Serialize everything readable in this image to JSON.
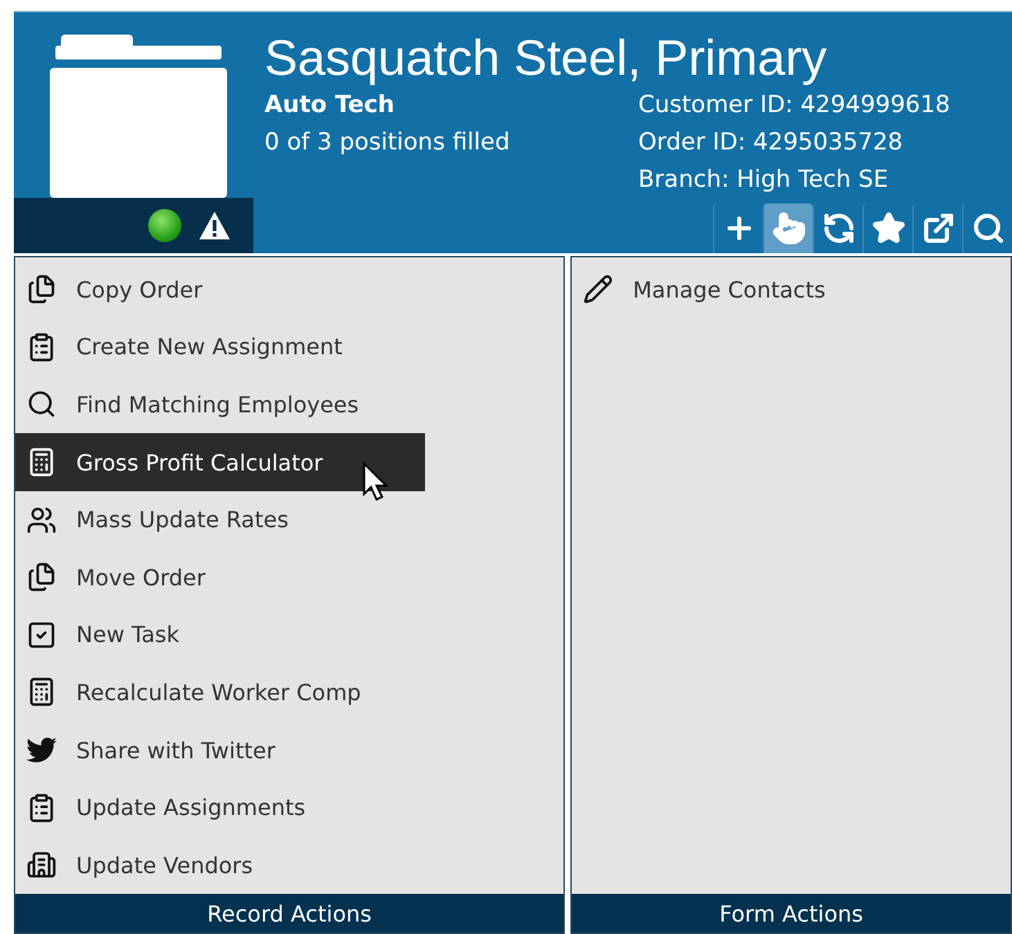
{
  "header": {
    "title": "Sasquatch Steel, Primary",
    "subtitle": "Auto Tech",
    "positions": "0 of 3 positions filled",
    "details": [
      "Customer ID: 4294999618",
      "Order ID: 4295035728",
      "Branch: High Tech SE"
    ]
  },
  "toolbar": [
    {
      "selected": false
    },
    {
      "selected": true
    },
    {
      "selected": false
    },
    {
      "selected": false
    },
    {
      "selected": false
    },
    {
      "selected": false
    }
  ],
  "record_actions": {
    "title": "Record Actions",
    "items": [
      {
        "label": "Copy Order",
        "selected": false
      },
      {
        "label": "Create New Assignment",
        "selected": false
      },
      {
        "label": "Find Matching Employees",
        "selected": false
      },
      {
        "label": "Gross Profit Calculator",
        "selected": true
      },
      {
        "label": "Mass Update Rates",
        "selected": false
      },
      {
        "label": "Move Order",
        "selected": false
      },
      {
        "label": "New Task",
        "selected": false
      },
      {
        "label": "Recalculate Worker Comp",
        "selected": false
      },
      {
        "label": "Share with Twitter",
        "selected": false
      },
      {
        "label": "Update Assignments",
        "selected": false
      },
      {
        "label": "Update Vendors",
        "selected": false
      }
    ]
  },
  "form_actions": {
    "title": "Form Actions",
    "items": [
      {
        "label": "Manage Contacts",
        "selected": false
      }
    ]
  }
}
